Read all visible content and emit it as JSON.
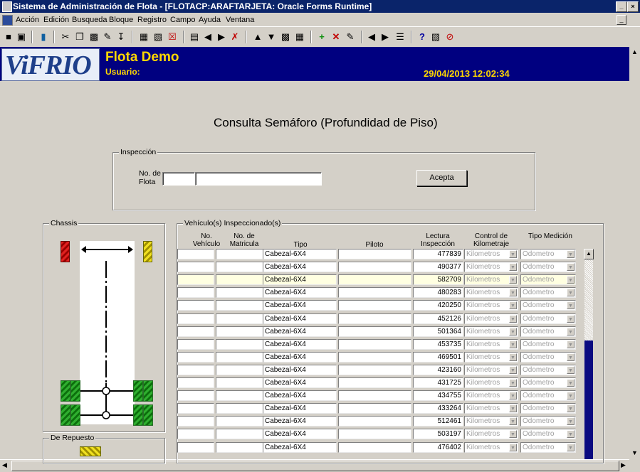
{
  "window": {
    "title": "Sistema de Administración de Flota - [FLOTACP:ARAFTARJETA: Oracle Forms Runtime]",
    "min_label": "_",
    "close_label": "×"
  },
  "menu": {
    "items": [
      "Acción",
      "Edición",
      "Busqueda",
      "Bloque",
      "Registro",
      "Campo",
      "Ayuda",
      "Ventana"
    ]
  },
  "banner": {
    "logo_text": "ViFRIO",
    "app_name": "Flota Demo",
    "user_label": "Usuario:",
    "datetime": "29/04/2013 12:02:34"
  },
  "form": {
    "title": "Consulta Semáforo (Profundidad de Piso)"
  },
  "inspeccion": {
    "group_label": "Inspección",
    "fleet_label_line1": "No. de",
    "fleet_label_line2": "Flota",
    "accept_label": "Acepta"
  },
  "chassis": {
    "group_label": "Chassis"
  },
  "repuesto": {
    "group_label": "De Repuesto"
  },
  "vehiculos": {
    "group_label": "Vehículo(s) Inspeccionado(s)",
    "headers": {
      "no_vehiculo": "No. Vehículo",
      "no_matricula": "No. de Matricula",
      "tipo": "Tipo",
      "piloto": "Piloto",
      "lectura": "Lectura Inspección",
      "control": "Control de Kilometraje",
      "medicion": "Tipo Medición"
    },
    "rows": [
      {
        "tipo": "Cabezal-6X4",
        "lectura": "477839",
        "control": "Kilometros",
        "medicion": "Odometro"
      },
      {
        "tipo": "Cabezal-6X4",
        "lectura": "490377",
        "control": "Kilometros",
        "medicion": "Odometro"
      },
      {
        "tipo": "Cabezal-6X4",
        "lectura": "582709",
        "control": "Kilometros",
        "medicion": "Odometro"
      },
      {
        "tipo": "Cabezal-6X4",
        "lectura": "480283",
        "control": "Kilometros",
        "medicion": "Odometro"
      },
      {
        "tipo": "Cabezal-6X4",
        "lectura": "420250",
        "control": "Kilometros",
        "medicion": "Odometro"
      },
      {
        "tipo": "Cabezal-6X4",
        "lectura": "452126",
        "control": "Kilometros",
        "medicion": "Odometro"
      },
      {
        "tipo": "Cabezal-6X4",
        "lectura": "501364",
        "control": "Kilometros",
        "medicion": "Odometro"
      },
      {
        "tipo": "Cabezal-6X4",
        "lectura": "453735",
        "control": "Kilometros",
        "medicion": "Odometro"
      },
      {
        "tipo": "Cabezal-6X4",
        "lectura": "469501",
        "control": "Kilometros",
        "medicion": "Odometro"
      },
      {
        "tipo": "Cabezal-6X4",
        "lectura": "423160",
        "control": "Kilometros",
        "medicion": "Odometro"
      },
      {
        "tipo": "Cabezal-6X4",
        "lectura": "431725",
        "control": "Kilometros",
        "medicion": "Odometro"
      },
      {
        "tipo": "Cabezal-6X4",
        "lectura": "434755",
        "control": "Kilometros",
        "medicion": "Odometro"
      },
      {
        "tipo": "Cabezal-6X4",
        "lectura": "433264",
        "control": "Kilometros",
        "medicion": "Odometro"
      },
      {
        "tipo": "Cabezal-6X4",
        "lectura": "512461",
        "control": "Kilometros",
        "medicion": "Odometro"
      },
      {
        "tipo": "Cabezal-6X4",
        "lectura": "503197",
        "control": "Kilometros",
        "medicion": "Odometro"
      },
      {
        "tipo": "Cabezal-6X4",
        "lectura": "476402",
        "control": "Kilometros",
        "medicion": "Odometro"
      }
    ],
    "selected_row": 3
  },
  "colors": {
    "banner_bg": "#000080",
    "banner_text": "#ffd700",
    "title_bar": "#0a246a",
    "selected_row": "#ffffe1",
    "scroll_thumb": "#0a0a80"
  }
}
